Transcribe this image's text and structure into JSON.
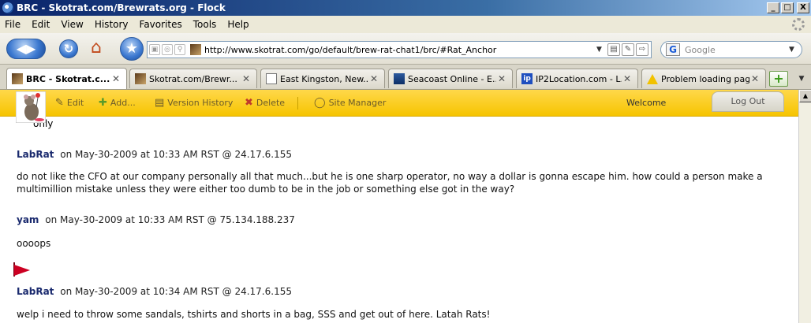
{
  "window": {
    "title": "BRC - Skotrat.com/Brewrats.org - Flock",
    "buttons": {
      "minimize": "_",
      "maximize": "□",
      "close": "X"
    }
  },
  "menu": {
    "items": [
      {
        "label": "File"
      },
      {
        "label": "Edit"
      },
      {
        "label": "View"
      },
      {
        "label": "History"
      },
      {
        "label": "Favorites"
      },
      {
        "label": "Tools"
      },
      {
        "label": "Help"
      }
    ]
  },
  "nav": {
    "url": "http://www.skotrat.com/go/default/brew-rat-chat1/brc/#Rat_Anchor",
    "search_placeholder": "Google",
    "google_letter": "G"
  },
  "tabs": [
    {
      "label": "BRC - Skotrat.c...",
      "icon": "rat-favicon",
      "active": true
    },
    {
      "label": "Skotrat.com/Brewr...",
      "icon": "rat-favicon",
      "active": false
    },
    {
      "label": "East Kingston, New...",
      "icon": "document-icon",
      "active": false
    },
    {
      "label": "Seacoast Online - E...",
      "icon": "seacoast-icon",
      "active": false
    },
    {
      "label": "IP2Location.com - L...",
      "icon": "ip-icon",
      "active": false
    },
    {
      "label": "Problem loading page",
      "icon": "warning-icon",
      "active": false
    }
  ],
  "tab_close_glyph": "✕",
  "ip_icon_text": "ip",
  "site_toolbar": {
    "edit": "Edit",
    "add": "Add...",
    "version_history": "Version History",
    "delete": "Delete",
    "site_manager": "Site Manager",
    "welcome": "Welcome",
    "logout": "Log Out"
  },
  "content": {
    "fragment": "only",
    "posts": [
      {
        "user": "LabRat",
        "meta": "on May-30-2009 at 10:33 AM RST @ 24.17.6.155",
        "body": "do not like the CFO at our company personally all that much...but he is one sharp operator, no way a dollar is gonna escape him. how could a person make a multimillion mistake unless they were either too dumb to be in the job or something else got in the way?"
      },
      {
        "user": "yam",
        "meta": "on May-30-2009 at 10:33 AM RST @ 75.134.188.237",
        "body": "oooops"
      },
      {
        "user": "LabRat",
        "meta": "on May-30-2009 at 10:34 AM RST @ 24.17.6.155",
        "body": "welp i need to throw some sandals, tshirts and shorts in a bag, SSS and get out of here. Latah Rats!"
      }
    ]
  }
}
